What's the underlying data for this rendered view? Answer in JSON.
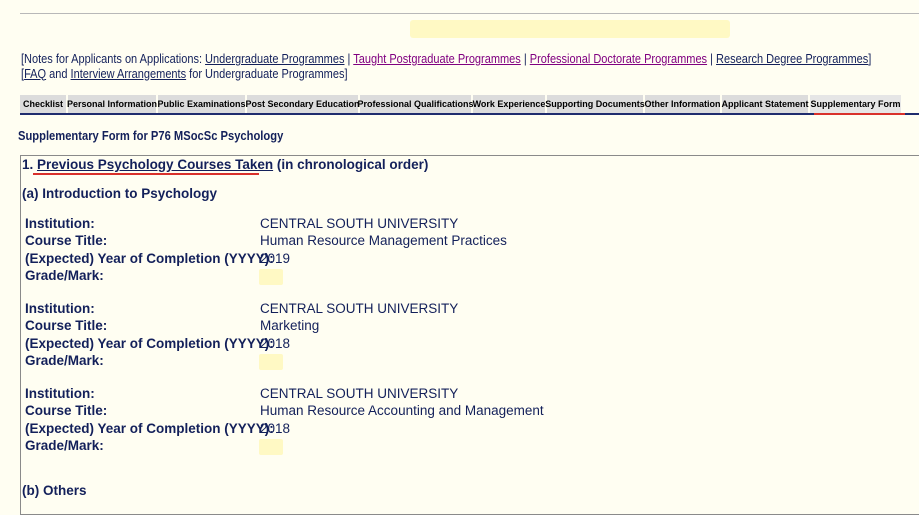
{
  "notes": {
    "line1_prefix": "[Notes for Applicants on Applications: ",
    "undergraduate": "Undergraduate Programmes",
    "sep1": " | ",
    "taught_pg": "Taught Postgraduate Programmes",
    "sep2": " | ",
    "prof_doct": "Professional Doctorate Programmes",
    "sep3": " | ",
    "research": "Research Degree Programmes",
    "line1_suffix": "]",
    "line2_prefix": "[",
    "faq": "FAQ",
    "and": " and ",
    "interview": "Interview Arrangements",
    "line2_suffix": " for Undergraduate Programmes]"
  },
  "tabs": [
    {
      "label": "Checklist",
      "active": false
    },
    {
      "label": "Personal Information",
      "active": false
    },
    {
      "label": "Public Examinations",
      "active": false
    },
    {
      "label": "Post Secondary Education",
      "active": false
    },
    {
      "label": "Professional Qualifications",
      "active": false
    },
    {
      "label": "Work Experience",
      "active": false
    },
    {
      "label": "Supporting Documents",
      "active": false
    },
    {
      "label": "Other Information",
      "active": false
    },
    {
      "label": "Applicant Statement",
      "active": false
    },
    {
      "label": "Supplementary Form",
      "active": true
    }
  ],
  "form_title": "Supplementary Form for P76 MSocSc Psychology",
  "section1": {
    "number": "1. ",
    "title_underlined": "Previous Psychology Courses Taken",
    "title_rest": " (in chronological order)"
  },
  "subsection_a": "(a) Introduction to Psychology",
  "labels": {
    "institution": "Institution:",
    "course_title": "Course Title:",
    "year": "(Expected) Year of Completion (YYYY):",
    "grade": "Grade/Mark:"
  },
  "courses": [
    {
      "institution": "CENTRAL SOUTH UNIVERSITY",
      "course_title": "Human Resource Management Practices",
      "year": "2019"
    },
    {
      "institution": "CENTRAL SOUTH UNIVERSITY",
      "course_title": "Marketing",
      "year": "2018"
    },
    {
      "institution": "CENTRAL SOUTH UNIVERSITY",
      "course_title": "Human Resource Accounting and Management",
      "year": "2018"
    }
  ],
  "subsection_b": "(b) Others",
  "colors": {
    "background": "#fffef2",
    "text": "#13205a",
    "link_visited": "#800080",
    "tab_bg": "#dcdcdc",
    "annotation_red": "#d9312b",
    "field_highlight": "#fff9c4"
  }
}
